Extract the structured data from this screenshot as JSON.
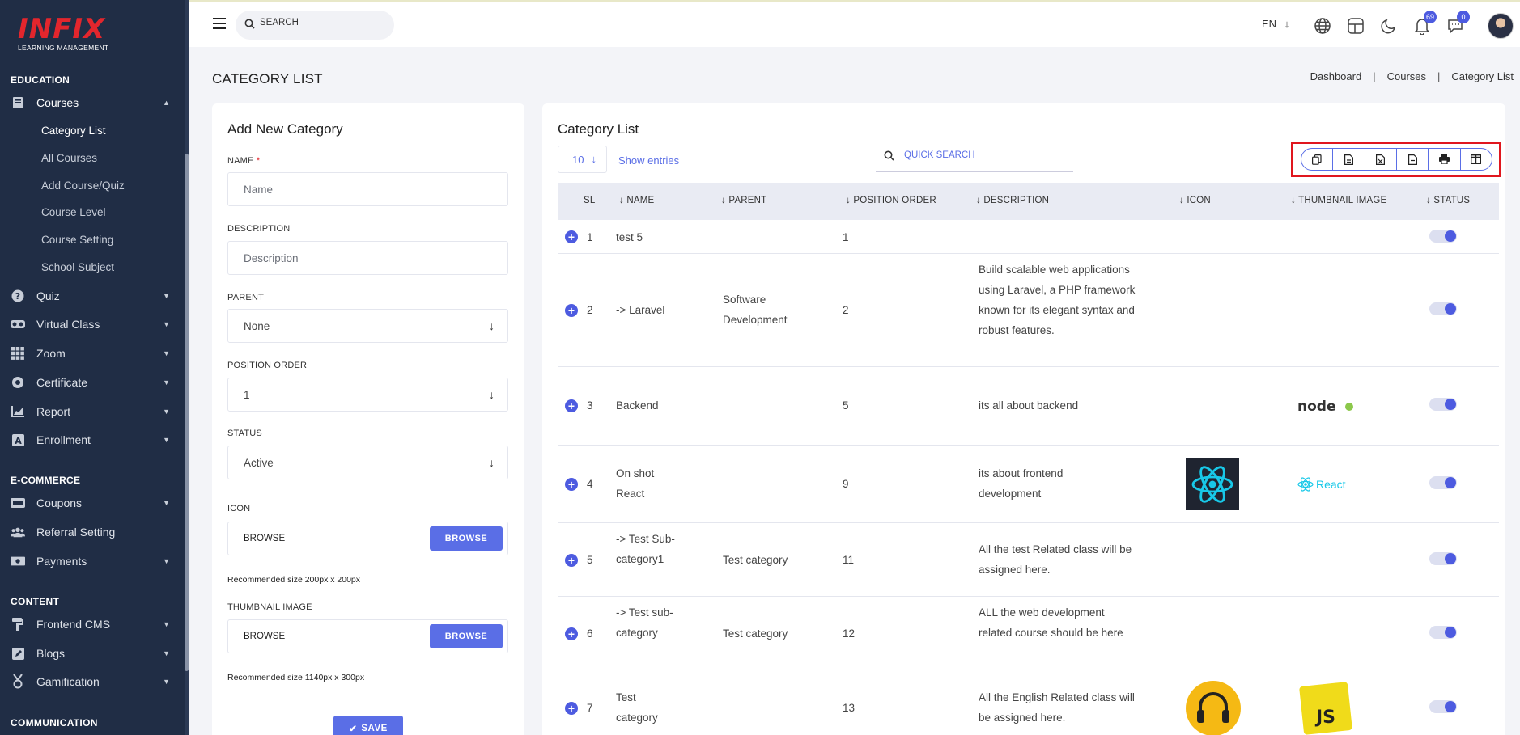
{
  "app": {
    "brand": "INFIX",
    "brand_sub": "LEARNING MANAGEMENT"
  },
  "sidebar": {
    "sections": [
      {
        "label": "EDUCATION"
      },
      {
        "label": "E-COMMERCE"
      },
      {
        "label": "CONTENT"
      },
      {
        "label": "COMMUNICATION"
      }
    ],
    "courses": {
      "label": "Courses",
      "icon": "book-icon"
    },
    "course_sub": [
      {
        "label": "Category List"
      },
      {
        "label": "All Courses"
      },
      {
        "label": "Add Course/Quiz"
      },
      {
        "label": "Course Level"
      },
      {
        "label": "Course Setting"
      },
      {
        "label": "School Subject"
      }
    ],
    "items": [
      {
        "label": "Quiz",
        "icon": "question-circle-icon"
      },
      {
        "label": "Virtual Class",
        "icon": "vr-glasses-icon"
      },
      {
        "label": "Zoom",
        "icon": "grid-icon"
      },
      {
        "label": "Certificate",
        "icon": "certificate-icon"
      },
      {
        "label": "Report",
        "icon": "chart-icon"
      },
      {
        "label": "Enrollment",
        "icon": "enrollment-icon"
      },
      {
        "label": "Coupons",
        "icon": "ticket-icon"
      },
      {
        "label": "Referral Setting",
        "icon": "users-icon"
      },
      {
        "label": "Payments",
        "icon": "money-icon"
      },
      {
        "label": "Frontend CMS",
        "icon": "paint-roller-icon"
      },
      {
        "label": "Blogs",
        "icon": "edit-icon"
      },
      {
        "label": "Gamification",
        "icon": "medal-icon"
      }
    ]
  },
  "topbar": {
    "search_placeholder": "SEARCH",
    "language": "EN",
    "notifications_count": "69",
    "messages_count": "0"
  },
  "page": {
    "title": "CATEGORY LIST",
    "breadcrumb": [
      "Dashboard",
      "Courses",
      "Category List"
    ]
  },
  "form": {
    "title": "Add New Category",
    "name_label": "NAME",
    "name_required": "*",
    "name_placeholder": "Name",
    "description_label": "DESCRIPTION",
    "description_placeholder": "Description",
    "parent_label": "PARENT",
    "parent_value": "None",
    "position_label": "POSITION ORDER",
    "position_value": "1",
    "status_label": "STATUS",
    "status_value": "Active",
    "icon_label": "ICON",
    "icon_browse_text": "BROWSE",
    "icon_browse_button": "BROWSE",
    "icon_hint": "Recommended size 200px x 200px",
    "thumb_label": "THUMBNAIL IMAGE",
    "thumb_browse_text": "BROWSE",
    "thumb_browse_button": "BROWSE",
    "thumb_hint": "Recommended size 1140px x 300px",
    "save_label": "SAVE"
  },
  "list": {
    "title": "Category List",
    "entries_value": "10",
    "entries_label": "Show entries",
    "quick_search_placeholder": "QUICK SEARCH",
    "export_buttons": [
      "copy-icon",
      "csv-file-icon",
      "excel-file-icon",
      "pdf-file-icon",
      "print-icon",
      "columns-icon"
    ],
    "columns": [
      "SL",
      "NAME",
      "PARENT",
      "POSITION ORDER",
      "DESCRIPTION",
      "ICON",
      "THUMBNAIL IMAGE",
      "STATUS"
    ],
    "rows": [
      {
        "sl": "1",
        "name": "test 5",
        "parent": "",
        "position": "1",
        "description": "",
        "icon": "",
        "thumbnail": "",
        "status": true
      },
      {
        "sl": "2",
        "name": "-> Laravel",
        "parent": "Software Development",
        "position": "2",
        "description": "Build scalable web applications using Laravel, a PHP framework known for its elegant syntax and robust features.",
        "icon": "",
        "thumbnail": "",
        "status": true
      },
      {
        "sl": "3",
        "name": "Backend",
        "parent": "",
        "position": "5",
        "description": "its all about backend",
        "icon": "",
        "thumbnail": "nodejs-logo",
        "status": true
      },
      {
        "sl": "4",
        "name": "On shot React",
        "parent": "",
        "position": "9",
        "description": "its about frontend development",
        "icon": "react-logo",
        "thumbnail": "react-wordmark",
        "status": true
      },
      {
        "sl": "5",
        "name": "-> Test Sub-category1",
        "parent": "Test category",
        "position": "11",
        "description": "All the test Related class will be assigned here.",
        "icon": "",
        "thumbnail": "",
        "status": true
      },
      {
        "sl": "6",
        "name": "-> Test sub-category",
        "parent": "Test category",
        "position": "12",
        "description": "ALL the web development related course should be here",
        "icon": "",
        "thumbnail": "",
        "status": true
      },
      {
        "sl": "7",
        "name": "Test category",
        "parent": "",
        "position": "13",
        "description": "All the English Related class will be assigned here.",
        "icon": "headphones-image",
        "thumbnail": "js-logo",
        "status": true
      }
    ],
    "thumb_texts": {
      "node": "node",
      "react": "React",
      "js": "JS"
    }
  },
  "colors": {
    "sidebar": "#202d45",
    "accent": "#4d5be0",
    "brand_red": "#e3262d",
    "highlight": "#e0161e"
  }
}
